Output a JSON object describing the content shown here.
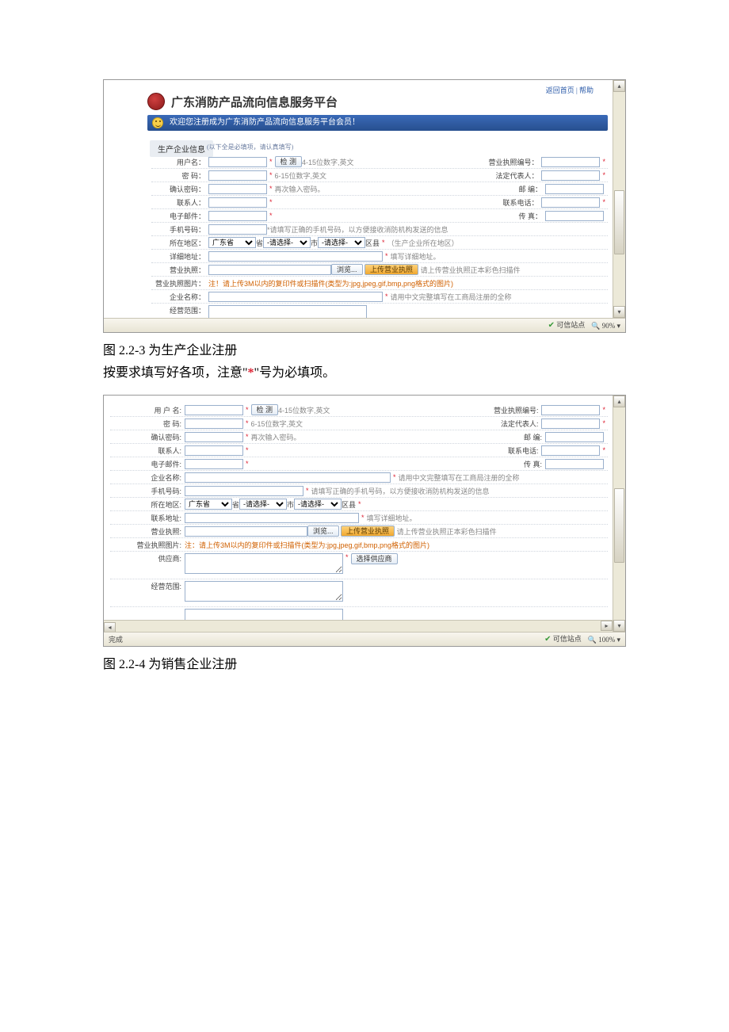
{
  "figure1": {
    "header": {
      "title": "广东消防产品流向信息服务平台",
      "topLinks": "返回首页 | 帮助"
    },
    "blueBar": "欢迎您注册成为广东消防产品流向信息服务平台会员！",
    "sectionTab": "生产企业信息",
    "sectionNote": "(以下全是必填项，请认真填写)",
    "rows": {
      "username": {
        "label": "用户名：",
        "btn": "检 测",
        "hint": "4-15位数字,英文"
      },
      "license": {
        "label": "营业执照编号："
      },
      "password": {
        "label": "密 码：",
        "hint": "6-15位数字,英文"
      },
      "legal": {
        "label": "法定代表人："
      },
      "confirm": {
        "label": "确认密码：",
        "hint": "再次输入密码。"
      },
      "post": {
        "label": "邮 编："
      },
      "contact": {
        "label": "联系人："
      },
      "phone": {
        "label": "联系电话："
      },
      "email": {
        "label": "电子邮件："
      },
      "fax": {
        "label": "传 真："
      },
      "mobile": {
        "label": "手机号码：",
        "hint": "*请填写正确的手机号码，以方便接收消防机构发送的信息"
      },
      "region": {
        "label": "所在地区：",
        "prov": "广东省",
        "provUnit": "省",
        "citySel": "-请选择-",
        "cityUnit": "市",
        "distSel": "-请选择-",
        "distUnit": "区县",
        "note": "（生产企业所在地区）"
      },
      "addr": {
        "label": "详细地址：",
        "hint": "填写详细地址。"
      },
      "bizlic": {
        "label": "营业执照：",
        "browse": "浏览...",
        "upload": "上传营业执照",
        "hint": "请上传营业执照正本彩色扫描件"
      },
      "bizimg": {
        "label": "营业执照图片：",
        "note": "注！请上传3M以内的复印件或扫描件(类型为:jpg,jpeg,gif,bmp,png格式的图片)"
      },
      "ename": {
        "label": "企业名称：",
        "hint": "请用中文完整填写在工商局注册的全称"
      },
      "scope": {
        "label": "经营范围："
      }
    },
    "status": {
      "left": "",
      "trust": "可信站点",
      "zoom": "90%"
    },
    "caption": "图 2.2-3 为生产企业注册",
    "desc1": "按要求填写好各项，注意\"",
    "descStar": "*",
    "desc2": "\"号为必填项。"
  },
  "figure2": {
    "rows": {
      "username": {
        "label": "用 户 名:",
        "btn": "检 测",
        "hint": "4-15位数字,英文"
      },
      "license": {
        "label": "营业执照编号:"
      },
      "password": {
        "label": "密   码:",
        "hint": "6-15位数字,英文"
      },
      "legal": {
        "label": "法定代表人:"
      },
      "confirm": {
        "label": "确认密码:",
        "hint": "再次输入密码。"
      },
      "post": {
        "label": "邮   编:"
      },
      "contact": {
        "label": "联系人:"
      },
      "phone": {
        "label": "联系电话:"
      },
      "email": {
        "label": "电子邮件:"
      },
      "fax": {
        "label": "传   真:"
      },
      "ename": {
        "label": "企业名称:",
        "hint": "请用中文完整填写在工商局注册的全称"
      },
      "mobile": {
        "label": "手机号码:",
        "hint": "请填写正确的手机号码，以方便接收消防机构发送的信息"
      },
      "region": {
        "label": "所在地区:",
        "prov": "广东省",
        "provUnit": "省",
        "citySel": "-请选择-",
        "cityUnit": "市",
        "distSel": "-请选择-",
        "distUnit": "区县"
      },
      "addr": {
        "label": "联系地址:",
        "hint": "填写详细地址。"
      },
      "bizlic": {
        "label": "营业执照:",
        "browse": "浏览...",
        "upload": "上传营业执照",
        "hint": "请上传营业执照正本彩色扫描件"
      },
      "bizimg": {
        "label": "营业执照图片:",
        "note": "注：请上传3M以内的复印件或扫描件(类型为:jpg,jpeg,gif,bmp,png格式的图片)"
      },
      "supplier": {
        "label": "供应商:",
        "btn": "选择供应商"
      },
      "scope": {
        "label": "经营范围:"
      }
    },
    "status": {
      "left": "完成",
      "trust": "可信站点",
      "zoom": "100%"
    },
    "caption": "图 2.2-4 为销售企业注册"
  },
  "req": "*"
}
